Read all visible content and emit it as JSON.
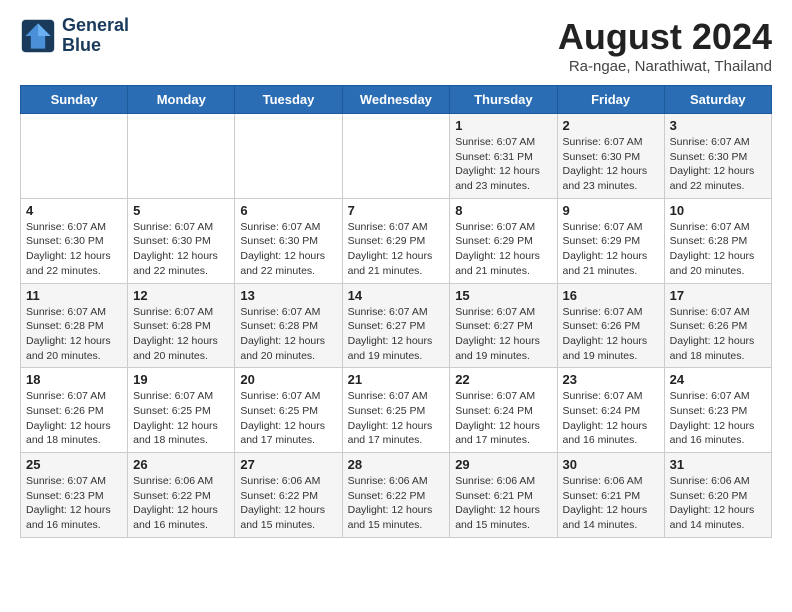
{
  "header": {
    "logo_line1": "General",
    "logo_line2": "Blue",
    "month_title": "August 2024",
    "location": "Ra-ngae, Narathiwat, Thailand"
  },
  "days_of_week": [
    "Sunday",
    "Monday",
    "Tuesday",
    "Wednesday",
    "Thursday",
    "Friday",
    "Saturday"
  ],
  "weeks": [
    [
      {
        "day": "",
        "info": ""
      },
      {
        "day": "",
        "info": ""
      },
      {
        "day": "",
        "info": ""
      },
      {
        "day": "",
        "info": ""
      },
      {
        "day": "1",
        "info": "Sunrise: 6:07 AM\nSunset: 6:31 PM\nDaylight: 12 hours\nand 23 minutes."
      },
      {
        "day": "2",
        "info": "Sunrise: 6:07 AM\nSunset: 6:30 PM\nDaylight: 12 hours\nand 23 minutes."
      },
      {
        "day": "3",
        "info": "Sunrise: 6:07 AM\nSunset: 6:30 PM\nDaylight: 12 hours\nand 22 minutes."
      }
    ],
    [
      {
        "day": "4",
        "info": "Sunrise: 6:07 AM\nSunset: 6:30 PM\nDaylight: 12 hours\nand 22 minutes."
      },
      {
        "day": "5",
        "info": "Sunrise: 6:07 AM\nSunset: 6:30 PM\nDaylight: 12 hours\nand 22 minutes."
      },
      {
        "day": "6",
        "info": "Sunrise: 6:07 AM\nSunset: 6:30 PM\nDaylight: 12 hours\nand 22 minutes."
      },
      {
        "day": "7",
        "info": "Sunrise: 6:07 AM\nSunset: 6:29 PM\nDaylight: 12 hours\nand 21 minutes."
      },
      {
        "day": "8",
        "info": "Sunrise: 6:07 AM\nSunset: 6:29 PM\nDaylight: 12 hours\nand 21 minutes."
      },
      {
        "day": "9",
        "info": "Sunrise: 6:07 AM\nSunset: 6:29 PM\nDaylight: 12 hours\nand 21 minutes."
      },
      {
        "day": "10",
        "info": "Sunrise: 6:07 AM\nSunset: 6:28 PM\nDaylight: 12 hours\nand 20 minutes."
      }
    ],
    [
      {
        "day": "11",
        "info": "Sunrise: 6:07 AM\nSunset: 6:28 PM\nDaylight: 12 hours\nand 20 minutes."
      },
      {
        "day": "12",
        "info": "Sunrise: 6:07 AM\nSunset: 6:28 PM\nDaylight: 12 hours\nand 20 minutes."
      },
      {
        "day": "13",
        "info": "Sunrise: 6:07 AM\nSunset: 6:28 PM\nDaylight: 12 hours\nand 20 minutes."
      },
      {
        "day": "14",
        "info": "Sunrise: 6:07 AM\nSunset: 6:27 PM\nDaylight: 12 hours\nand 19 minutes."
      },
      {
        "day": "15",
        "info": "Sunrise: 6:07 AM\nSunset: 6:27 PM\nDaylight: 12 hours\nand 19 minutes."
      },
      {
        "day": "16",
        "info": "Sunrise: 6:07 AM\nSunset: 6:26 PM\nDaylight: 12 hours\nand 19 minutes."
      },
      {
        "day": "17",
        "info": "Sunrise: 6:07 AM\nSunset: 6:26 PM\nDaylight: 12 hours\nand 18 minutes."
      }
    ],
    [
      {
        "day": "18",
        "info": "Sunrise: 6:07 AM\nSunset: 6:26 PM\nDaylight: 12 hours\nand 18 minutes."
      },
      {
        "day": "19",
        "info": "Sunrise: 6:07 AM\nSunset: 6:25 PM\nDaylight: 12 hours\nand 18 minutes."
      },
      {
        "day": "20",
        "info": "Sunrise: 6:07 AM\nSunset: 6:25 PM\nDaylight: 12 hours\nand 17 minutes."
      },
      {
        "day": "21",
        "info": "Sunrise: 6:07 AM\nSunset: 6:25 PM\nDaylight: 12 hours\nand 17 minutes."
      },
      {
        "day": "22",
        "info": "Sunrise: 6:07 AM\nSunset: 6:24 PM\nDaylight: 12 hours\nand 17 minutes."
      },
      {
        "day": "23",
        "info": "Sunrise: 6:07 AM\nSunset: 6:24 PM\nDaylight: 12 hours\nand 16 minutes."
      },
      {
        "day": "24",
        "info": "Sunrise: 6:07 AM\nSunset: 6:23 PM\nDaylight: 12 hours\nand 16 minutes."
      }
    ],
    [
      {
        "day": "25",
        "info": "Sunrise: 6:07 AM\nSunset: 6:23 PM\nDaylight: 12 hours\nand 16 minutes."
      },
      {
        "day": "26",
        "info": "Sunrise: 6:06 AM\nSunset: 6:22 PM\nDaylight: 12 hours\nand 16 minutes."
      },
      {
        "day": "27",
        "info": "Sunrise: 6:06 AM\nSunset: 6:22 PM\nDaylight: 12 hours\nand 15 minutes."
      },
      {
        "day": "28",
        "info": "Sunrise: 6:06 AM\nSunset: 6:22 PM\nDaylight: 12 hours\nand 15 minutes."
      },
      {
        "day": "29",
        "info": "Sunrise: 6:06 AM\nSunset: 6:21 PM\nDaylight: 12 hours\nand 15 minutes."
      },
      {
        "day": "30",
        "info": "Sunrise: 6:06 AM\nSunset: 6:21 PM\nDaylight: 12 hours\nand 14 minutes."
      },
      {
        "day": "31",
        "info": "Sunrise: 6:06 AM\nSunset: 6:20 PM\nDaylight: 12 hours\nand 14 minutes."
      }
    ]
  ]
}
